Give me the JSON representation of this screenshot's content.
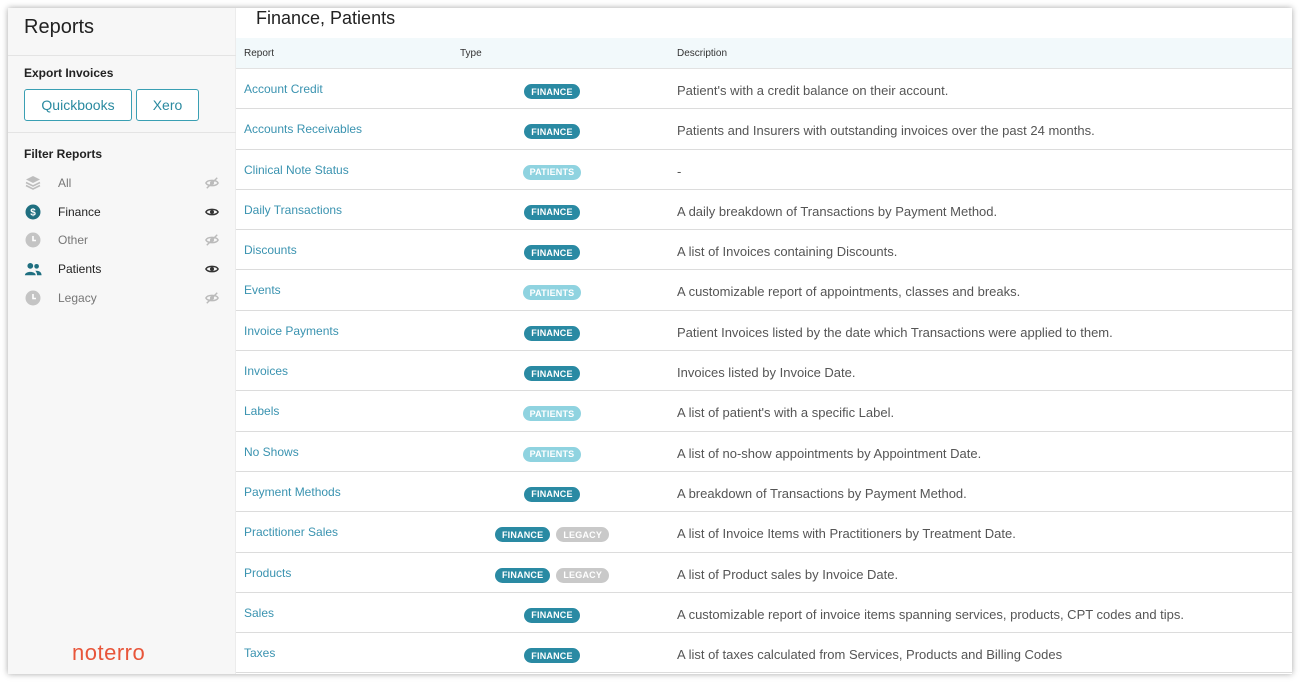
{
  "sidebar": {
    "title": "Reports",
    "export_title": "Export Invoices",
    "export_buttons": [
      "Quickbooks",
      "Xero"
    ],
    "filter_title": "Filter Reports",
    "filters": [
      {
        "label": "All",
        "icon": "layers-icon",
        "active": false
      },
      {
        "label": "Finance",
        "icon": "dollar-icon",
        "active": true
      },
      {
        "label": "Other",
        "icon": "clock-icon",
        "active": false
      },
      {
        "label": "Patients",
        "icon": "users-icon",
        "active": true
      },
      {
        "label": "Legacy",
        "icon": "clock-icon",
        "active": false
      }
    ],
    "logo": "noterro"
  },
  "main": {
    "title": "Finance, Patients",
    "columns": [
      "Report",
      "Type",
      "Description"
    ],
    "rows": [
      {
        "name": "Account Credit",
        "types": [
          "FINANCE"
        ],
        "description": "Patient's with a credit balance on their account."
      },
      {
        "name": "Accounts Receivables",
        "types": [
          "FINANCE"
        ],
        "description": "Patients and Insurers with outstanding invoices over the past 24 months."
      },
      {
        "name": "Clinical Note Status",
        "types": [
          "PATIENTS"
        ],
        "description": "-"
      },
      {
        "name": "Daily Transactions",
        "types": [
          "FINANCE"
        ],
        "description": "A daily breakdown of Transactions by Payment Method."
      },
      {
        "name": "Discounts",
        "types": [
          "FINANCE"
        ],
        "description": "A list of Invoices containing Discounts."
      },
      {
        "name": "Events",
        "types": [
          "PATIENTS"
        ],
        "description": "A customizable report of appointments, classes and breaks."
      },
      {
        "name": "Invoice Payments",
        "types": [
          "FINANCE"
        ],
        "description": "Patient Invoices listed by the date which Transactions were applied to them."
      },
      {
        "name": "Invoices",
        "types": [
          "FINANCE"
        ],
        "description": "Invoices listed by Invoice Date."
      },
      {
        "name": "Labels",
        "types": [
          "PATIENTS"
        ],
        "description": "A list of patient's with a specific Label."
      },
      {
        "name": "No Shows",
        "types": [
          "PATIENTS"
        ],
        "description": "A list of no-show appointments by Appointment Date."
      },
      {
        "name": "Payment Methods",
        "types": [
          "FINANCE"
        ],
        "description": "A breakdown of Transactions by Payment Method."
      },
      {
        "name": "Practitioner Sales",
        "types": [
          "FINANCE",
          "LEGACY"
        ],
        "description": "A list of Invoice Items with Practitioners by Treatment Date."
      },
      {
        "name": "Products",
        "types": [
          "FINANCE",
          "LEGACY"
        ],
        "description": "A list of Product sales by Invoice Date."
      },
      {
        "name": "Sales",
        "types": [
          "FINANCE"
        ],
        "description": "A customizable report of invoice items spanning services, products, CPT codes and tips."
      },
      {
        "name": "Taxes",
        "types": [
          "FINANCE"
        ],
        "description": "A list of taxes calculated from Services, Products and Billing Codes"
      }
    ]
  },
  "colors": {
    "FINANCE": "#2a8aa3",
    "PATIENTS": "#8fd3e0",
    "LEGACY": "#c9c9c9",
    "accent": "#3a93b0",
    "logo": "#e8553a"
  }
}
